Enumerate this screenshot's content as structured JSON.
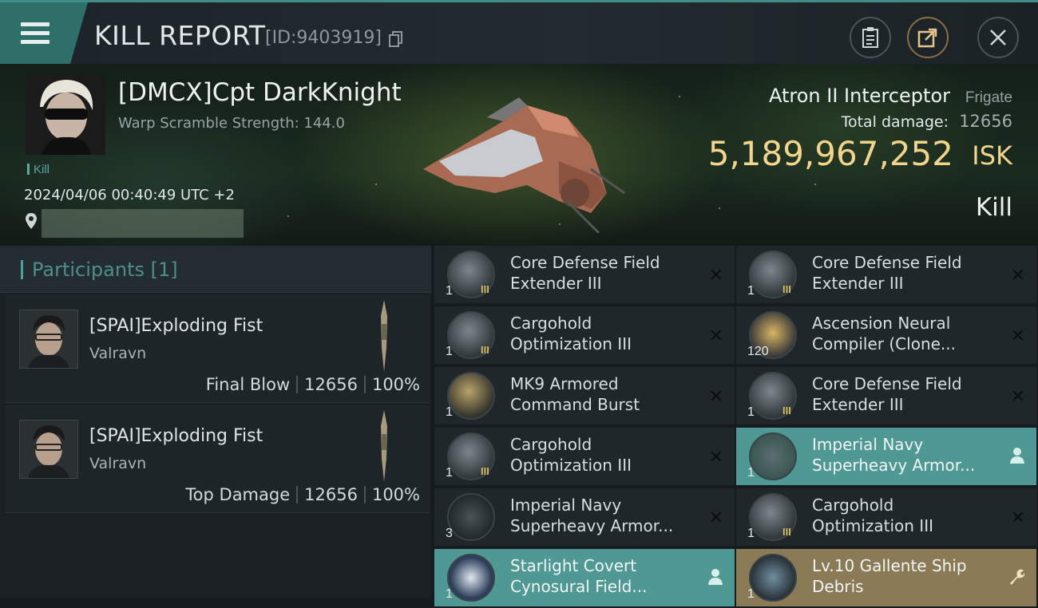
{
  "header": {
    "title": "KILL REPORT",
    "kill_id": "[ID:9403919]"
  },
  "victim": {
    "pilot_name": "[DMCX]Cpt DarkKnight",
    "warp_scramble": "Warp Scramble Strength: 144.0",
    "tag": "Kill",
    "datetime": "2024/04/06 00:40:49 UTC +2",
    "ship_name": "Atron II Interceptor",
    "ship_class": "Frigate",
    "total_damage_label": "Total damage:",
    "total_damage": "12656",
    "isk_value": "5,189,967,252",
    "isk_unit": "ISK",
    "outcome": "Kill"
  },
  "participants": {
    "header": "Participants [1]",
    "rows": [
      {
        "name": "[SPAI]Exploding Fist",
        "ship": "Valravn",
        "role": "Final Blow",
        "damage": "12656",
        "percent": "100%"
      },
      {
        "name": "[SPAI]Exploding Fist",
        "ship": "Valravn",
        "role": "Top Damage",
        "damage": "12656",
        "percent": "100%"
      }
    ]
  },
  "items": [
    {
      "name": "Core Defense Field Extender III",
      "qty": "1",
      "level": "III",
      "state": "destroyed",
      "icon": "shield-module-icon"
    },
    {
      "name": "Core Defense Field Extender III",
      "qty": "1",
      "level": "III",
      "state": "destroyed",
      "icon": "shield-module-icon"
    },
    {
      "name": "Cargohold Optimization III",
      "qty": "1",
      "level": "III",
      "state": "destroyed",
      "icon": "cargo-rig-icon"
    },
    {
      "name": "Ascension Neural Compiler (Clone...",
      "qty": "120",
      "level": "",
      "state": "destroyed",
      "icon": "neural-compiler-icon"
    },
    {
      "name": "MK9 Armored Command Burst",
      "qty": "1",
      "level": "",
      "state": "destroyed",
      "icon": "command-burst-icon"
    },
    {
      "name": "Core Defense Field Extender III",
      "qty": "1",
      "level": "III",
      "state": "destroyed",
      "icon": "shield-module-icon"
    },
    {
      "name": "Cargohold Optimization III",
      "qty": "1",
      "level": "III",
      "state": "destroyed",
      "icon": "cargo-rig-icon"
    },
    {
      "name": "Imperial Navy Superheavy Armor...",
      "qty": "1",
      "level": "",
      "state": "dropped",
      "icon": "ship-blueprint-icon"
    },
    {
      "name": "Imperial Navy Superheavy Armor...",
      "qty": "3",
      "level": "",
      "state": "destroyed",
      "icon": "ship-blueprint-icon"
    },
    {
      "name": "Cargohold Optimization III",
      "qty": "1",
      "level": "III",
      "state": "destroyed",
      "icon": "cargo-rig-icon"
    },
    {
      "name": "Starlight Covert Cynosural Field...",
      "qty": "1",
      "level": "",
      "state": "dropped",
      "icon": "cyno-module-icon"
    },
    {
      "name": "Lv.10 Gallente Ship Debris",
      "qty": "1",
      "level": "",
      "state": "salvage",
      "icon": "ship-debris-icon"
    }
  ],
  "colors": {
    "accent_teal": "#4f9893",
    "isk_gold": "#f2d48c",
    "salvage_gold": "#8a7a55",
    "header_teal": "#2f6f6a"
  }
}
